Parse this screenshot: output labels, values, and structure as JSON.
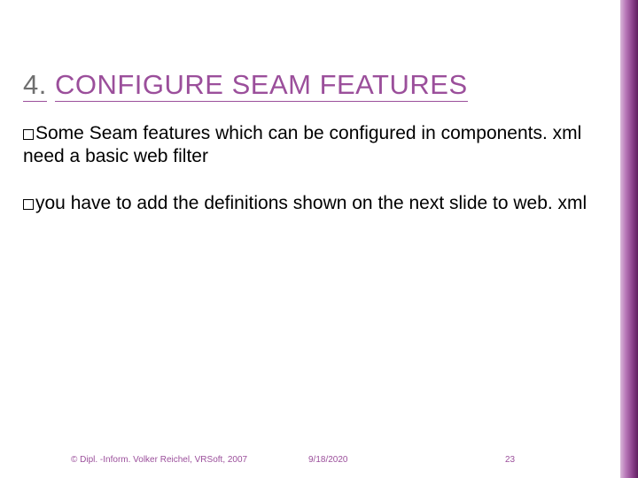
{
  "title": {
    "prefix": "4.",
    "rest": "CONFIGURE SEAM FEATURES"
  },
  "bullets": [
    {
      "lead": "Some",
      "rest": " Seam features which can be configured in components. xml need a basic web filter"
    },
    {
      "lead": "you",
      "rest": " have to add the definitions shown on the next slide to web. xml"
    }
  ],
  "footer": {
    "copyright": "© Dipl. -Inform. Volker Reichel, VRSoft, 2007",
    "date": "9/18/2020",
    "page": "23"
  }
}
